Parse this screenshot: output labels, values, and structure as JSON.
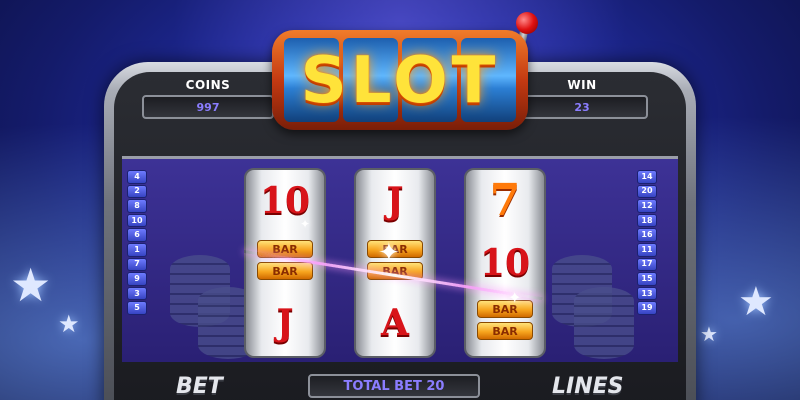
{
  "game": {
    "logo": "SLOT",
    "coins": {
      "label": "COINS",
      "value": "997"
    },
    "win": {
      "label": "WIN",
      "value": "23"
    },
    "paylines_left": [
      "4",
      "2",
      "8",
      "10",
      "6",
      "1",
      "7",
      "9",
      "3",
      "5"
    ],
    "paylines_right": [
      "14",
      "20",
      "12",
      "18",
      "16",
      "11",
      "17",
      "15",
      "13",
      "19"
    ],
    "reels": [
      {
        "top": "10",
        "middle": [
          "BAR",
          "BAR"
        ],
        "bottom": "J"
      },
      {
        "top": "J",
        "middle": [
          "BAR",
          "BAR"
        ],
        "bottom": "A"
      },
      {
        "top": "7",
        "middle": "10",
        "bottom": [
          "BAR",
          "BAR"
        ]
      }
    ],
    "controls": {
      "bet_label": "BET",
      "total_bet": "TOTAL BET 20",
      "lines_label": "LINES"
    }
  },
  "colors": {
    "accent_text": "#8b7dff",
    "symbol_red": "#d8141a",
    "logo_gold": "#ffe33a"
  }
}
